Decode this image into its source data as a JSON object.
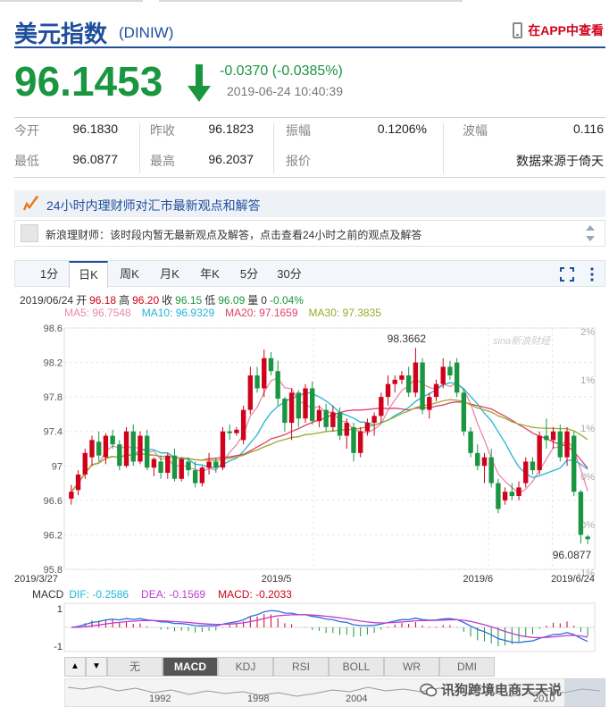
{
  "header": {
    "name": "美元指数",
    "code": "(DINIW)",
    "app_link": "在APP中查看"
  },
  "quote": {
    "price": "96.1453",
    "change": "-0.0370 (-0.0385%)",
    "time": "2019-06-24 10:40:39",
    "direction": "down"
  },
  "stats": {
    "row1": [
      {
        "label": "今开",
        "value": "96.1830"
      },
      {
        "label": "昨收",
        "value": "96.1823"
      },
      {
        "label": "振幅",
        "value": "0.1206%"
      },
      {
        "label": "波幅",
        "value": "0.116"
      }
    ],
    "row2": [
      {
        "label": "最低",
        "value": "96.0877"
      },
      {
        "label": "最高",
        "value": "96.2037"
      },
      {
        "label": "报价",
        "value": "数据来源于倚天"
      }
    ]
  },
  "advisor": {
    "title": "24小时内理财师对汇市最新观点和解答",
    "message": "新浪理财师：该时段内暂无最新观点及解答，点击查看24小时之前的观点及解答"
  },
  "chart_tabs": [
    "1分",
    "日K",
    "周K",
    "月K",
    "年K",
    "5分",
    "30分"
  ],
  "active_tab": "日K",
  "ohlc_line": {
    "date": "2019/06/24",
    "open_label": "开",
    "open": "96.18",
    "high_label": "高",
    "high": "96.20",
    "close_label": "收",
    "close": "96.15",
    "low_label": "低",
    "low": "96.09",
    "vol_label": "量",
    "vol": "0",
    "pct": "-0.04%"
  },
  "ma_line": {
    "ma5": "MA5: 96.7548",
    "ma10": "MA10: 96.9329",
    "ma20": "MA20: 97.1659",
    "ma30": "MA30: 97.3835"
  },
  "colors": {
    "up": "#d0021b",
    "down": "#1a9641",
    "ma5": "#e88aa8",
    "ma10": "#22b5d8",
    "ma20": "#e0416a",
    "ma30": "#9aaa2a",
    "brand": "#1f4e9c"
  },
  "chart_data": {
    "type": "candlestick",
    "y_ticks": [
      "98.6",
      "98.2",
      "97.8",
      "97.4",
      "97",
      "96.6",
      "96.2",
      "95.8"
    ],
    "ylim": [
      95.8,
      98.6
    ],
    "pct_ticks": [
      "2%",
      "1%",
      "1%",
      "0%",
      "0%",
      "-1%"
    ],
    "x_labels": [
      "2019/3/27",
      "2019/5",
      "2019/6",
      "2019/6/24"
    ],
    "annotations": {
      "max": "98.3662",
      "min": "96.0877"
    },
    "watermark": "sina新浪财经",
    "candles": [
      [
        96.62,
        96.78,
        96.55,
        96.7
      ],
      [
        96.72,
        96.95,
        96.66,
        96.9
      ],
      [
        96.9,
        97.2,
        96.85,
        97.15
      ],
      [
        97.1,
        97.35,
        97.0,
        97.3
      ],
      [
        97.28,
        97.4,
        97.05,
        97.12
      ],
      [
        97.1,
        97.38,
        97.02,
        97.35
      ],
      [
        97.35,
        97.42,
        97.2,
        97.25
      ],
      [
        97.25,
        97.3,
        96.95,
        97.0
      ],
      [
        97.0,
        97.45,
        96.98,
        97.4
      ],
      [
        97.4,
        97.48,
        97.0,
        97.05
      ],
      [
        97.05,
        97.4,
        97.02,
        97.35
      ],
      [
        97.35,
        97.42,
        96.95,
        96.98
      ],
      [
        96.98,
        97.1,
        96.88,
        97.08
      ],
      [
        97.05,
        97.12,
        96.85,
        96.92
      ],
      [
        96.92,
        97.15,
        96.85,
        97.12
      ],
      [
        97.12,
        97.2,
        96.82,
        96.85
      ],
      [
        96.85,
        97.1,
        96.82,
        97.08
      ],
      [
        97.05,
        97.1,
        96.88,
        96.95
      ],
      [
        96.95,
        97.05,
        96.75,
        96.8
      ],
      [
        96.8,
        97.0,
        96.76,
        96.98
      ],
      [
        96.98,
        97.15,
        96.9,
        97.05
      ],
      [
        97.05,
        97.1,
        96.92,
        96.98
      ],
      [
        96.98,
        97.45,
        96.95,
        97.4
      ],
      [
        97.4,
        97.48,
        97.3,
        97.38
      ],
      [
        97.38,
        97.45,
        97.35,
        97.42
      ],
      [
        97.3,
        97.7,
        97.25,
        97.65
      ],
      [
        97.65,
        98.15,
        97.6,
        98.05
      ],
      [
        98.05,
        98.15,
        97.85,
        97.9
      ],
      [
        97.9,
        98.35,
        97.8,
        98.25
      ],
      [
        98.25,
        98.32,
        98.05,
        98.1
      ],
      [
        98.1,
        98.22,
        97.7,
        97.78
      ],
      [
        97.78,
        97.8,
        97.4,
        97.5
      ],
      [
        97.5,
        97.9,
        97.3,
        97.85
      ],
      [
        97.85,
        97.88,
        97.45,
        97.55
      ],
      [
        97.55,
        97.95,
        97.5,
        97.9
      ],
      [
        97.9,
        97.98,
        97.48,
        97.52
      ],
      [
        97.52,
        97.7,
        97.45,
        97.65
      ],
      [
        97.65,
        97.72,
        97.4,
        97.45
      ],
      [
        97.45,
        97.7,
        97.4,
        97.62
      ],
      [
        97.62,
        97.68,
        97.3,
        97.35
      ],
      [
        97.35,
        97.55,
        97.2,
        97.5
      ],
      [
        97.45,
        97.5,
        97.05,
        97.15
      ],
      [
        97.15,
        97.45,
        97.1,
        97.4
      ],
      [
        97.4,
        97.55,
        97.35,
        97.5
      ],
      [
        97.5,
        97.62,
        97.35,
        97.58
      ],
      [
        97.58,
        97.85,
        97.5,
        97.8
      ],
      [
        97.8,
        98.05,
        97.7,
        97.95
      ],
      [
        97.95,
        98.05,
        97.85,
        98.0
      ],
      [
        98.0,
        98.1,
        97.95,
        98.05
      ],
      [
        98.05,
        98.15,
        97.8,
        97.85
      ],
      [
        97.85,
        98.37,
        97.8,
        98.2
      ],
      [
        98.2,
        98.25,
        97.6,
        97.65
      ],
      [
        97.65,
        97.85,
        97.55,
        97.8
      ],
      [
        97.8,
        98.0,
        97.75,
        97.95
      ],
      [
        97.95,
        98.25,
        97.9,
        98.15
      ],
      [
        98.15,
        98.22,
        98.0,
        98.05
      ],
      [
        98.2,
        98.25,
        97.8,
        97.85
      ],
      [
        97.85,
        97.9,
        97.35,
        97.4
      ],
      [
        97.4,
        97.45,
        97.1,
        97.15
      ],
      [
        97.15,
        97.25,
        96.95,
        97.0
      ],
      [
        97.0,
        97.15,
        96.8,
        97.1
      ],
      [
        97.1,
        97.2,
        96.75,
        96.8
      ],
      [
        96.8,
        96.85,
        96.45,
        96.5
      ],
      [
        96.6,
        96.75,
        96.55,
        96.7
      ],
      [
        96.7,
        96.8,
        96.6,
        96.65
      ],
      [
        96.65,
        96.82,
        96.6,
        96.75
      ],
      [
        96.8,
        97.1,
        96.75,
        97.05
      ],
      [
        97.05,
        97.1,
        96.9,
        96.95
      ],
      [
        96.95,
        97.4,
        96.9,
        97.35
      ],
      [
        97.35,
        97.55,
        97.2,
        97.3
      ],
      [
        97.3,
        97.45,
        97.2,
        97.4
      ],
      [
        97.4,
        97.48,
        97.05,
        97.1
      ],
      [
        97.1,
        97.45,
        97.0,
        97.4
      ],
      [
        97.35,
        97.4,
        96.65,
        96.7
      ],
      [
        96.7,
        96.72,
        96.1,
        96.2
      ],
      [
        96.18,
        96.2,
        96.09,
        96.15
      ]
    ],
    "macd_labels": {
      "title": "MACD",
      "dif": "DIF: -0.2586",
      "dea": "DEA: -0.1569",
      "macd": "MACD: -0.2033"
    },
    "macd_ticks": [
      "1",
      "-1"
    ],
    "macd_ylim": [
      -1.3,
      1.3
    ]
  },
  "indicators": [
    "无",
    "MACD",
    "KDJ",
    "RSI",
    "BOLL",
    "WR",
    "DMI"
  ],
  "active_indicator": "MACD",
  "nav_labels": [
    "1992",
    "1998",
    "2004",
    "2010"
  ],
  "watermark_text": "讯狗跨境电商天天说"
}
